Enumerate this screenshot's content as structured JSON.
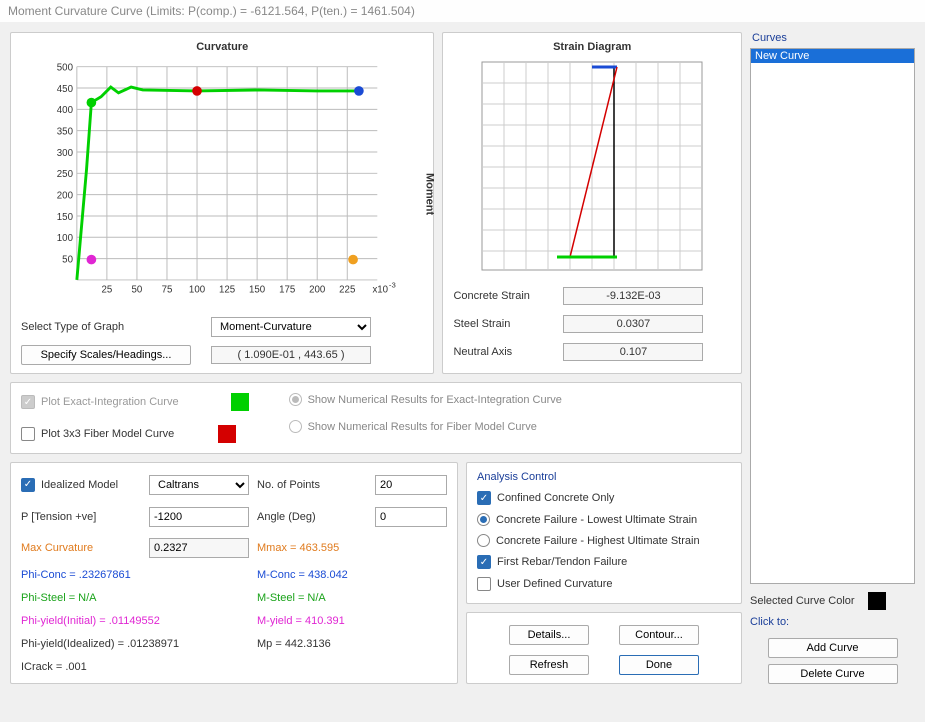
{
  "window_title": "Moment Curvature Curve (Limits:  P(comp.) = -6121.564, P(ten.) = 1461.504)",
  "curvature": {
    "title": "Curvature",
    "moment_label": "Moment",
    "x_exp": "x10",
    "x_exp_sup": "-3",
    "select_type_label": "Select Type of Graph",
    "graph_type": "Moment-Curvature",
    "specify_btn": "Specify Scales/Headings...",
    "cursor_readout": "( 1.090E-01 , 443.65 )"
  },
  "strain": {
    "title": "Strain Diagram",
    "concrete_label": "Concrete Strain",
    "concrete_val": "-9.132E-03",
    "steel_label": "Steel Strain",
    "steel_val": "0.0307",
    "neutral_label": "Neutral Axis",
    "neutral_val": "0.107"
  },
  "plot_opts": {
    "exact_label": "Plot Exact-Integration Curve",
    "fiber_label": "Plot 3x3 Fiber Model Curve",
    "show_exact_label": "Show Numerical Results for Exact-Integration Curve",
    "show_fiber_label": "Show Numerical Results for Fiber Model Curve"
  },
  "results": {
    "idealized_label": "Idealized Model",
    "idealized_sel": "Caltrans",
    "npoints_label": "No. of Points",
    "npoints_val": "20",
    "p_label": "P [Tension +ve]",
    "p_val": "-1200",
    "angle_label": "Angle (Deg)",
    "angle_val": "0",
    "maxcurv_label": "Max Curvature",
    "maxcurv_val": "0.2327",
    "mmax_label": "Mmax = 463.595",
    "phiconc_label": "Phi-Conc = .23267861",
    "mconc_label": "M-Conc = 438.042",
    "phisteel_label": "Phi-Steel = N/A",
    "msteel_label": "M-Steel = N/A",
    "phiyield_init_label": "Phi-yield(Initial) = .01149552",
    "myield_label": "M-yield = 410.391",
    "phiyield_ideal_label": "Phi-yield(Idealized) = .01238971",
    "mp_label": "Mp = 442.3136",
    "icrack_label": "ICrack =  .001"
  },
  "analysis": {
    "title": "Analysis Control",
    "confined": "Confined Concrete Only",
    "lowest": "Concrete Failure - Lowest Ultimate Strain",
    "highest": "Concrete Failure - Highest Ultimate Strain",
    "rebar": "First Rebar/Tendon Failure",
    "userdef": "User Defined Curvature",
    "details_btn": "Details...",
    "contour_btn": "Contour...",
    "refresh_btn": "Refresh",
    "done_btn": "Done"
  },
  "curves": {
    "title": "Curves",
    "items": [
      "New Curve"
    ],
    "sel_color_label": "Selected Curve Color",
    "click_to": "Click to:",
    "add_btn": "Add Curve",
    "del_btn": "Delete Curve"
  },
  "chart_data": {
    "type": "line",
    "title": "Curvature",
    "xlabel": "Curvature ×10⁻³",
    "ylabel": "Moment",
    "xlim": [
      0,
      250
    ],
    "ylim": [
      0,
      500
    ],
    "x_ticks": [
      25,
      50,
      75,
      100,
      125,
      150,
      175,
      200,
      225
    ],
    "y_ticks": [
      50,
      100,
      150,
      200,
      250,
      300,
      350,
      400,
      450,
      500
    ],
    "series": [
      {
        "name": "Exact-Integration Curve",
        "color": "#00d000",
        "x": [
          0,
          8,
          12,
          20,
          28,
          35,
          45,
          55,
          100,
          150,
          200,
          235
        ],
        "y": [
          0,
          260,
          415,
          430,
          452,
          438,
          452,
          445,
          444,
          445,
          444,
          444
        ]
      }
    ],
    "markers": [
      {
        "name": "green-start",
        "x": 12,
        "y": 415,
        "color": "#00d000"
      },
      {
        "name": "red-mid",
        "x": 100,
        "y": 444,
        "color": "#d40000"
      },
      {
        "name": "blue-end",
        "x": 235,
        "y": 444,
        "color": "#1a4bd4"
      },
      {
        "name": "magenta-low",
        "x": 12,
        "y": 48,
        "color": "#e026d3"
      },
      {
        "name": "orange-low",
        "x": 230,
        "y": 48,
        "color": "#f0a020"
      }
    ]
  }
}
